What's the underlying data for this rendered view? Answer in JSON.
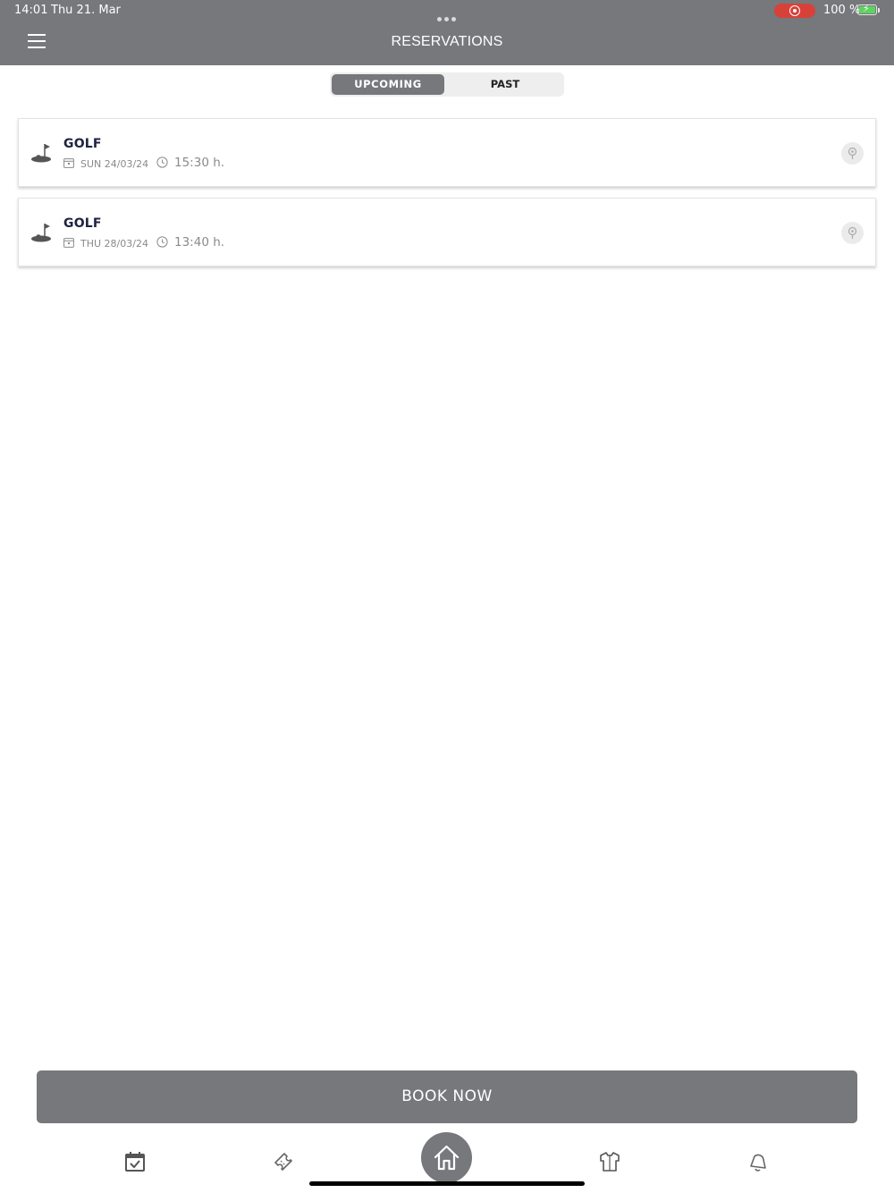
{
  "status_bar": {
    "time": "14:01",
    "date": "Thu 21. Mar",
    "battery": "100 %"
  },
  "header": {
    "title": "RESERVATIONS"
  },
  "tabs": {
    "upcoming": "UPCOMING",
    "past": "PAST",
    "selected": "UPCOMING"
  },
  "reservations": [
    {
      "sport": "GOLF",
      "date": "SUN 24/03/24",
      "time": "15:30 h."
    },
    {
      "sport": "GOLF",
      "date": "THU 28/03/24",
      "time": "13:40 h."
    }
  ],
  "book_button": {
    "label": "BOOK NOW"
  },
  "bottom_nav": {
    "items": [
      "calendar-check-icon",
      "ticket-icon",
      "home-icon",
      "shirt-icon",
      "bell-icon"
    ]
  },
  "colors": {
    "header_bg": "#76787b",
    "accent": "#76787b",
    "record_red": "#d8413a",
    "battery_green": "#5fd35f",
    "sport_title": "#1f2340"
  }
}
